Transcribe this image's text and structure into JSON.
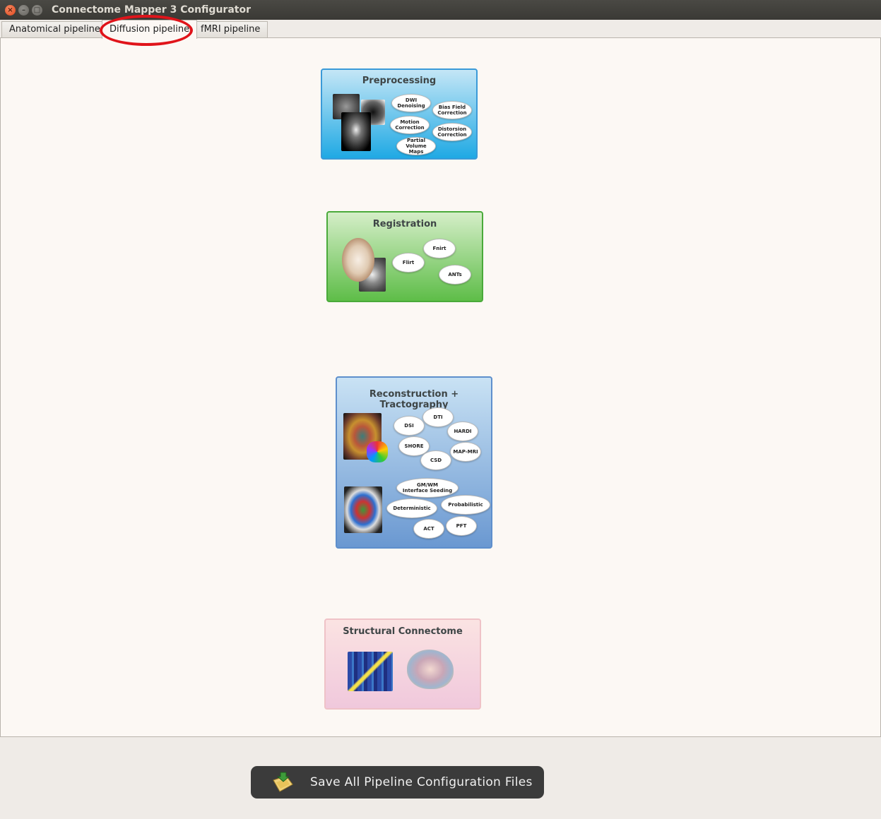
{
  "window": {
    "title": "Connectome Mapper 3 Configurator",
    "controls": [
      "close",
      "minimize",
      "maximize"
    ]
  },
  "tabs": [
    {
      "label": "Anatomical pipeline",
      "active": false
    },
    {
      "label": "Diffusion pipeline",
      "active": true
    },
    {
      "label": "fMRI pipeline",
      "active": false
    }
  ],
  "stages": {
    "preprocessing": {
      "title": "Preprocessing",
      "bubbles": [
        "DWI\nDenoising",
        "Bias Field\nCorrection",
        "Motion\nCorrection",
        "Distorsion\nCorrection",
        "Partial Volume\nMaps"
      ]
    },
    "registration": {
      "title": "Registration",
      "bubbles": [
        "Fnirt",
        "Flirt",
        "ANTs"
      ]
    },
    "reconstruction": {
      "title": "Reconstruction + Tractography",
      "recon_bubbles": [
        "DTI",
        "DSI",
        "HARDI",
        "SHORE",
        "MAP-MRI",
        "CSD"
      ],
      "tract_bubbles": [
        "GM/WM\nInterface Seeding",
        "Deterministic",
        "Probabilistic",
        "ACT",
        "PFT"
      ]
    },
    "connectome": {
      "title": "Structural Connectome"
    }
  },
  "save_button": {
    "label": "Save All Pipeline Configuration Files",
    "icon": "save-config-icon"
  },
  "colors": {
    "preprocessing": "#1fa9e4",
    "registration": "#5ebd48",
    "reconstruction": "#6a98d1",
    "connectome": "#f0c8dc",
    "highlight": "#e0141a"
  }
}
